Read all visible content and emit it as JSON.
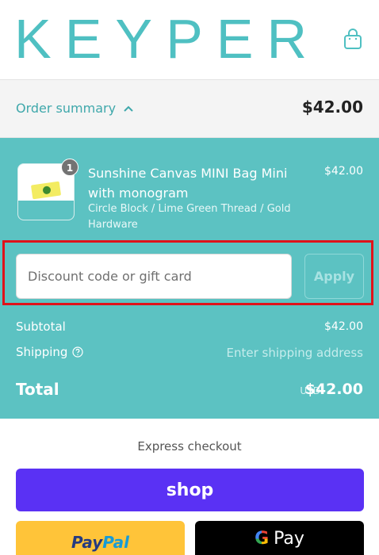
{
  "header": {
    "logo_text": "KEYPER",
    "cart_icon": "shopping-bag-icon",
    "brand_color": "#4fc0c2"
  },
  "summary": {
    "toggle_label": "Order summary",
    "toggle_icon": "chevron-up-icon",
    "total": "$42.00"
  },
  "order": {
    "item": {
      "quantity": "1",
      "name": "Sunshine Canvas MINI Bag Mini with monogram",
      "variant": "Circle Block / Lime Green Thread / Gold Hardware",
      "price": "$42.00"
    },
    "discount": {
      "placeholder": "Discount code or gift card",
      "value": "",
      "apply_label": "Apply"
    },
    "subtotal_label": "Subtotal",
    "subtotal_value": "$42.00",
    "shipping_label": "Shipping",
    "shipping_value": "Enter shipping address",
    "total_label": "Total",
    "total_currency": "USD",
    "total_value": "$42.00",
    "panel_color": "#5cc2c2",
    "highlight_color": "#e0121a"
  },
  "express": {
    "title": "Express checkout",
    "shop_label": "shop",
    "paypal_part1": "Pay",
    "paypal_part2": "Pal",
    "gpay_g": "G",
    "gpay_label": "Pay"
  }
}
